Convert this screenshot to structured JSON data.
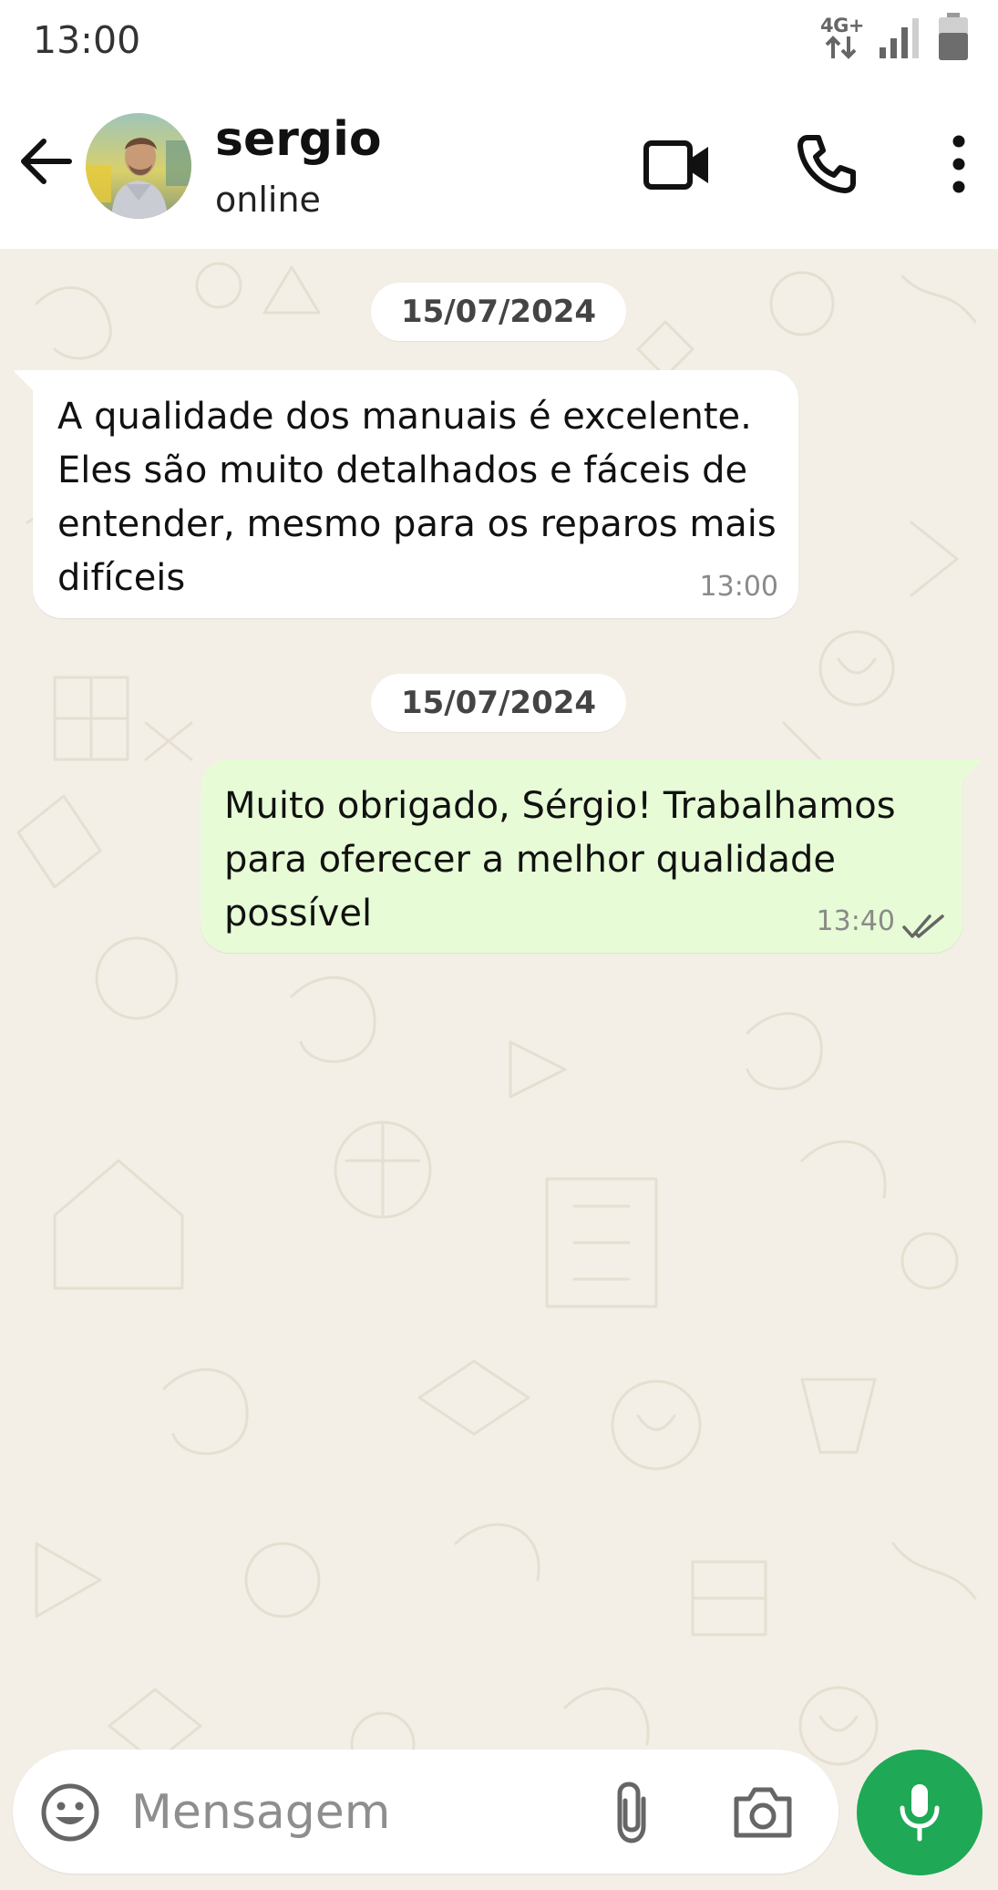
{
  "status_bar": {
    "time": "13:00",
    "network": "4G+",
    "icons": [
      "network-arrows-icon",
      "signal-icon",
      "battery-icon"
    ]
  },
  "header": {
    "contact_name": "sergio",
    "contact_status": "online",
    "icons": [
      "back-arrow-icon",
      "avatar",
      "video-call-icon",
      "phone-call-icon",
      "more-options-icon"
    ]
  },
  "messages": [
    {
      "date": "15/07/2024",
      "direction": "incoming",
      "text": "A qualidade dos manuais é excelente.\nEles são muito detalhados e fáceis de\nentender, mesmo para os reparos mais\ndifíceis",
      "time": "13:00"
    },
    {
      "date": "15/07/2024",
      "direction": "outgoing",
      "text": "Muito obrigado, Sérgio! Trabalhamos\npara oferecer a melhor qualidade\npossível",
      "time": "13:40",
      "status": "read"
    }
  ],
  "composer": {
    "placeholder": "Mensagem",
    "value": "",
    "icons": [
      "emoji-icon",
      "attach-icon",
      "camera-icon",
      "mic-icon"
    ]
  },
  "colors": {
    "chat_background": "#f3efe6",
    "incoming_bubble": "#ffffff",
    "outgoing_bubble": "#e7fcd6",
    "accent_green": "#1fa855",
    "read_ticks": "#666666"
  }
}
